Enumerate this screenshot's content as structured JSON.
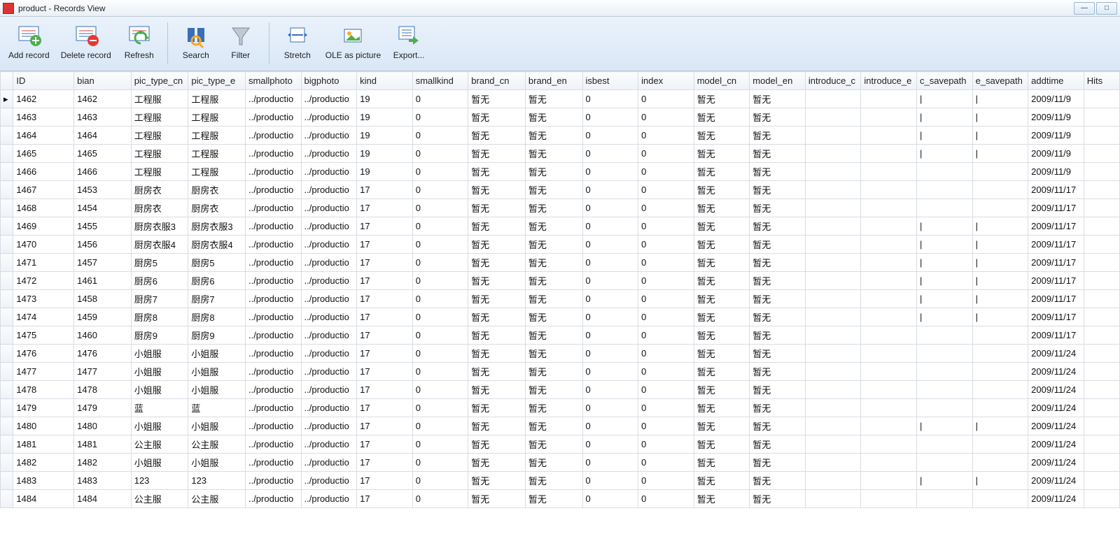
{
  "window": {
    "title": "product - Records View"
  },
  "toolbar": {
    "add": "Add record",
    "delete": "Delete record",
    "refresh": "Refresh",
    "search": "Search",
    "filter": "Filter",
    "stretch": "Stretch",
    "ole": "OLE as picture",
    "export": "Export..."
  },
  "columns": [
    "ID",
    "bian",
    "pic_type_cn",
    "pic_type_e",
    "smallphoto",
    "bigphoto",
    "kind",
    "smallkind",
    "brand_cn",
    "brand_en",
    "isbest",
    "index",
    "model_cn",
    "model_en",
    "introduce_c",
    "introduce_e",
    "c_savepath",
    "e_savepath",
    "addtime",
    "Hits"
  ],
  "rows": [
    {
      "ID": "1462",
      "bian": "1462",
      "pic_type_cn": "工程服",
      "pic_type_e": "工程服",
      "smallphoto": "../productio",
      "bigphoto": "../productio",
      "kind": "19",
      "smallkind": "0",
      "brand_cn": "暂无",
      "brand_en": "暂无",
      "isbest": "0",
      "index": "0",
      "model_cn": "暂无",
      "model_en": "暂无",
      "introduce_c": "",
      "introduce_e": "",
      "c_savepath": "|",
      "e_savepath": "|",
      "addtime": "2009/11/9",
      "Hits": ""
    },
    {
      "ID": "1463",
      "bian": "1463",
      "pic_type_cn": "工程服",
      "pic_type_e": "工程服",
      "smallphoto": "../productio",
      "bigphoto": "../productio",
      "kind": "19",
      "smallkind": "0",
      "brand_cn": "暂无",
      "brand_en": "暂无",
      "isbest": "0",
      "index": "0",
      "model_cn": "暂无",
      "model_en": "暂无",
      "introduce_c": "",
      "introduce_e": "",
      "c_savepath": "|",
      "e_savepath": "|",
      "addtime": "2009/11/9",
      "Hits": ""
    },
    {
      "ID": "1464",
      "bian": "1464",
      "pic_type_cn": "工程服",
      "pic_type_e": "工程服",
      "smallphoto": "../productio",
      "bigphoto": "../productio",
      "kind": "19",
      "smallkind": "0",
      "brand_cn": "暂无",
      "brand_en": "暂无",
      "isbest": "0",
      "index": "0",
      "model_cn": "暂无",
      "model_en": "暂无",
      "introduce_c": "",
      "introduce_e": "",
      "c_savepath": "|",
      "e_savepath": "|",
      "addtime": "2009/11/9",
      "Hits": ""
    },
    {
      "ID": "1465",
      "bian": "1465",
      "pic_type_cn": "工程服",
      "pic_type_e": "工程服",
      "smallphoto": "../productio",
      "bigphoto": "../productio",
      "kind": "19",
      "smallkind": "0",
      "brand_cn": "暂无",
      "brand_en": "暂无",
      "isbest": "0",
      "index": "0",
      "model_cn": "暂无",
      "model_en": "暂无",
      "introduce_c": "",
      "introduce_e": "",
      "c_savepath": "|",
      "e_savepath": "|",
      "addtime": "2009/11/9",
      "Hits": ""
    },
    {
      "ID": "1466",
      "bian": "1466",
      "pic_type_cn": "工程服",
      "pic_type_e": "工程服",
      "smallphoto": "../productio",
      "bigphoto": "../productio",
      "kind": "19",
      "smallkind": "0",
      "brand_cn": "暂无",
      "brand_en": "暂无",
      "isbest": "0",
      "index": "0",
      "model_cn": "暂无",
      "model_en": "暂无",
      "introduce_c": "",
      "introduce_e": "",
      "c_savepath": "",
      "e_savepath": "",
      "addtime": "2009/11/9",
      "Hits": ""
    },
    {
      "ID": "1467",
      "bian": "1453",
      "pic_type_cn": "厨房衣",
      "pic_type_e": "厨房衣",
      "smallphoto": "../productio",
      "bigphoto": "../productio",
      "kind": "17",
      "smallkind": "0",
      "brand_cn": "暂无",
      "brand_en": "暂无",
      "isbest": "0",
      "index": "0",
      "model_cn": "暂无",
      "model_en": "暂无",
      "introduce_c": "",
      "introduce_e": "",
      "c_savepath": "",
      "e_savepath": "",
      "addtime": "2009/11/17",
      "Hits": ""
    },
    {
      "ID": "1468",
      "bian": "1454",
      "pic_type_cn": "厨房衣",
      "pic_type_e": "厨房衣",
      "smallphoto": "../productio",
      "bigphoto": "../productio",
      "kind": "17",
      "smallkind": "0",
      "brand_cn": "暂无",
      "brand_en": "暂无",
      "isbest": "0",
      "index": "0",
      "model_cn": "暂无",
      "model_en": "暂无",
      "introduce_c": "",
      "introduce_e": "",
      "c_savepath": "",
      "e_savepath": "",
      "addtime": "2009/11/17",
      "Hits": ""
    },
    {
      "ID": "1469",
      "bian": "1455",
      "pic_type_cn": "厨房衣服3",
      "pic_type_e": "厨房衣服3",
      "smallphoto": "../productio",
      "bigphoto": "../productio",
      "kind": "17",
      "smallkind": "0",
      "brand_cn": "暂无",
      "brand_en": "暂无",
      "isbest": "0",
      "index": "0",
      "model_cn": "暂无",
      "model_en": "暂无",
      "introduce_c": "",
      "introduce_e": "",
      "c_savepath": "|",
      "e_savepath": "|",
      "addtime": "2009/11/17",
      "Hits": ""
    },
    {
      "ID": "1470",
      "bian": "1456",
      "pic_type_cn": "厨房衣服4",
      "pic_type_e": "厨房衣服4",
      "smallphoto": "../productio",
      "bigphoto": "../productio",
      "kind": "17",
      "smallkind": "0",
      "brand_cn": "暂无",
      "brand_en": "暂无",
      "isbest": "0",
      "index": "0",
      "model_cn": "暂无",
      "model_en": "暂无",
      "introduce_c": "",
      "introduce_e": "",
      "c_savepath": "|",
      "e_savepath": "|",
      "addtime": "2009/11/17",
      "Hits": ""
    },
    {
      "ID": "1471",
      "bian": "1457",
      "pic_type_cn": "厨房5",
      "pic_type_e": "厨房5",
      "smallphoto": "../productio",
      "bigphoto": "../productio",
      "kind": "17",
      "smallkind": "0",
      "brand_cn": "暂无",
      "brand_en": "暂无",
      "isbest": "0",
      "index": "0",
      "model_cn": "暂无",
      "model_en": "暂无",
      "introduce_c": "",
      "introduce_e": "",
      "c_savepath": "|",
      "e_savepath": "|",
      "addtime": "2009/11/17",
      "Hits": ""
    },
    {
      "ID": "1472",
      "bian": "1461",
      "pic_type_cn": "厨房6",
      "pic_type_e": "厨房6",
      "smallphoto": "../productio",
      "bigphoto": "../productio",
      "kind": "17",
      "smallkind": "0",
      "brand_cn": "暂无",
      "brand_en": "暂无",
      "isbest": "0",
      "index": "0",
      "model_cn": "暂无",
      "model_en": "暂无",
      "introduce_c": "",
      "introduce_e": "",
      "c_savepath": "|",
      "e_savepath": "|",
      "addtime": "2009/11/17",
      "Hits": ""
    },
    {
      "ID": "1473",
      "bian": "1458",
      "pic_type_cn": "厨房7",
      "pic_type_e": "厨房7",
      "smallphoto": "../productio",
      "bigphoto": "../productio",
      "kind": "17",
      "smallkind": "0",
      "brand_cn": "暂无",
      "brand_en": "暂无",
      "isbest": "0",
      "index": "0",
      "model_cn": "暂无",
      "model_en": "暂无",
      "introduce_c": "",
      "introduce_e": "",
      "c_savepath": "|",
      "e_savepath": "|",
      "addtime": "2009/11/17",
      "Hits": ""
    },
    {
      "ID": "1474",
      "bian": "1459",
      "pic_type_cn": "厨房8",
      "pic_type_e": "厨房8",
      "smallphoto": "../productio",
      "bigphoto": "../productio",
      "kind": "17",
      "smallkind": "0",
      "brand_cn": "暂无",
      "brand_en": "暂无",
      "isbest": "0",
      "index": "0",
      "model_cn": "暂无",
      "model_en": "暂无",
      "introduce_c": "",
      "introduce_e": "",
      "c_savepath": "|",
      "e_savepath": "|",
      "addtime": "2009/11/17",
      "Hits": ""
    },
    {
      "ID": "1475",
      "bian": "1460",
      "pic_type_cn": "厨房9",
      "pic_type_e": "厨房9",
      "smallphoto": "../productio",
      "bigphoto": "../productio",
      "kind": "17",
      "smallkind": "0",
      "brand_cn": "暂无",
      "brand_en": "暂无",
      "isbest": "0",
      "index": "0",
      "model_cn": "暂无",
      "model_en": "暂无",
      "introduce_c": "",
      "introduce_e": "",
      "c_savepath": "",
      "e_savepath": "",
      "addtime": "2009/11/17",
      "Hits": ""
    },
    {
      "ID": "1476",
      "bian": "1476",
      "pic_type_cn": "小姐服",
      "pic_type_e": "小姐服",
      "smallphoto": "../productio",
      "bigphoto": "../productio",
      "kind": "17",
      "smallkind": "0",
      "brand_cn": "暂无",
      "brand_en": "暂无",
      "isbest": "0",
      "index": "0",
      "model_cn": "暂无",
      "model_en": "暂无",
      "introduce_c": "",
      "introduce_e": "",
      "c_savepath": "",
      "e_savepath": "",
      "addtime": "2009/11/24",
      "Hits": ""
    },
    {
      "ID": "1477",
      "bian": "1477",
      "pic_type_cn": "小姐服",
      "pic_type_e": "小姐服",
      "smallphoto": "../productio",
      "bigphoto": "../productio",
      "kind": "17",
      "smallkind": "0",
      "brand_cn": "暂无",
      "brand_en": "暂无",
      "isbest": "0",
      "index": "0",
      "model_cn": "暂无",
      "model_en": "暂无",
      "introduce_c": "",
      "introduce_e": "",
      "c_savepath": "",
      "e_savepath": "",
      "addtime": "2009/11/24",
      "Hits": ""
    },
    {
      "ID": "1478",
      "bian": "1478",
      "pic_type_cn": "小姐服",
      "pic_type_e": "小姐服",
      "smallphoto": "../productio",
      "bigphoto": "../productio",
      "kind": "17",
      "smallkind": "0",
      "brand_cn": "暂无",
      "brand_en": "暂无",
      "isbest": "0",
      "index": "0",
      "model_cn": "暂无",
      "model_en": "暂无",
      "introduce_c": "",
      "introduce_e": "",
      "c_savepath": "",
      "e_savepath": "",
      "addtime": "2009/11/24",
      "Hits": ""
    },
    {
      "ID": "1479",
      "bian": "1479",
      "pic_type_cn": "蓝",
      "pic_type_e": "蓝",
      "smallphoto": "../productio",
      "bigphoto": "../productio",
      "kind": "17",
      "smallkind": "0",
      "brand_cn": "暂无",
      "brand_en": "暂无",
      "isbest": "0",
      "index": "0",
      "model_cn": "暂无",
      "model_en": "暂无",
      "introduce_c": "",
      "introduce_e": "",
      "c_savepath": "",
      "e_savepath": "",
      "addtime": "2009/11/24",
      "Hits": ""
    },
    {
      "ID": "1480",
      "bian": "1480",
      "pic_type_cn": "小姐服",
      "pic_type_e": "小姐服",
      "smallphoto": "../productio",
      "bigphoto": "../productio",
      "kind": "17",
      "smallkind": "0",
      "brand_cn": "暂无",
      "brand_en": "暂无",
      "isbest": "0",
      "index": "0",
      "model_cn": "暂无",
      "model_en": "暂无",
      "introduce_c": "",
      "introduce_e": "",
      "c_savepath": "|",
      "e_savepath": "|",
      "addtime": "2009/11/24",
      "Hits": ""
    },
    {
      "ID": "1481",
      "bian": "1481",
      "pic_type_cn": "公主服",
      "pic_type_e": "公主服",
      "smallphoto": "../productio",
      "bigphoto": "../productio",
      "kind": "17",
      "smallkind": "0",
      "brand_cn": "暂无",
      "brand_en": "暂无",
      "isbest": "0",
      "index": "0",
      "model_cn": "暂无",
      "model_en": "暂无",
      "introduce_c": "",
      "introduce_e": "",
      "c_savepath": "",
      "e_savepath": "",
      "addtime": "2009/11/24",
      "Hits": ""
    },
    {
      "ID": "1482",
      "bian": "1482",
      "pic_type_cn": "小姐服",
      "pic_type_e": "小姐服",
      "smallphoto": "../productio",
      "bigphoto": "../productio",
      "kind": "17",
      "smallkind": "0",
      "brand_cn": "暂无",
      "brand_en": "暂无",
      "isbest": "0",
      "index": "0",
      "model_cn": "暂无",
      "model_en": "暂无",
      "introduce_c": "",
      "introduce_e": "",
      "c_savepath": "",
      "e_savepath": "",
      "addtime": "2009/11/24",
      "Hits": ""
    },
    {
      "ID": "1483",
      "bian": "1483",
      "pic_type_cn": "123",
      "pic_type_e": "123",
      "smallphoto": "../productio",
      "bigphoto": "../productio",
      "kind": "17",
      "smallkind": "0",
      "brand_cn": "暂无",
      "brand_en": "暂无",
      "isbest": "0",
      "index": "0",
      "model_cn": "暂无",
      "model_en": "暂无",
      "introduce_c": "",
      "introduce_e": "",
      "c_savepath": "|",
      "e_savepath": "|",
      "addtime": "2009/11/24",
      "Hits": ""
    },
    {
      "ID": "1484",
      "bian": "1484",
      "pic_type_cn": "公主服",
      "pic_type_e": "公主服",
      "smallphoto": "../productio",
      "bigphoto": "../productio",
      "kind": "17",
      "smallkind": "0",
      "brand_cn": "暂无",
      "brand_en": "暂无",
      "isbest": "0",
      "index": "0",
      "model_cn": "暂无",
      "model_en": "暂无",
      "introduce_c": "",
      "introduce_e": "",
      "c_savepath": "",
      "e_savepath": "",
      "addtime": "2009/11/24",
      "Hits": ""
    }
  ],
  "numericCols": [
    "ID",
    "bian",
    "kind",
    "smallkind",
    "isbest",
    "index"
  ],
  "colWidths": {
    "rowhdr": 18,
    "ID": 85,
    "bian": 80,
    "pic_type_cn": 80,
    "pic_type_e": 80,
    "smallphoto": 78,
    "bigphoto": 78,
    "kind": 78,
    "smallkind": 78,
    "brand_cn": 80,
    "brand_en": 80,
    "isbest": 78,
    "index": 78,
    "model_cn": 78,
    "model_en": 78,
    "introduce_c": 78,
    "introduce_e": 78,
    "c_savepath": 78,
    "e_savepath": 78,
    "addtime": 78,
    "Hits": 50
  }
}
